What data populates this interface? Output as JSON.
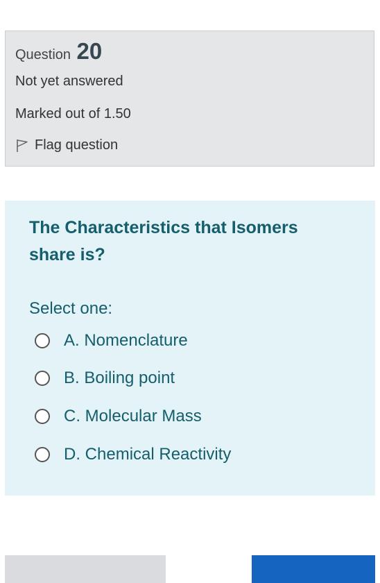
{
  "info": {
    "question_label": "Question",
    "question_number": "20",
    "status": "Not yet answered",
    "marks": "Marked out of 1.50",
    "flag_label": "Flag question"
  },
  "question": {
    "text": "The Characteristics that Isomers share is?",
    "prompt": "Select one:",
    "options": [
      {
        "label": "A. Nomenclature"
      },
      {
        "label": "B. Boiling point"
      },
      {
        "label": "C. Molecular Mass"
      },
      {
        "label": "D. Chemical Reactivity"
      }
    ]
  },
  "colors": {
    "info_bg": "#e4e6e8",
    "question_bg": "#e4f3f7",
    "question_text": "#155e6c",
    "next_button": "#1565c0"
  },
  "icons": {
    "flag": "flag-outline-icon"
  }
}
